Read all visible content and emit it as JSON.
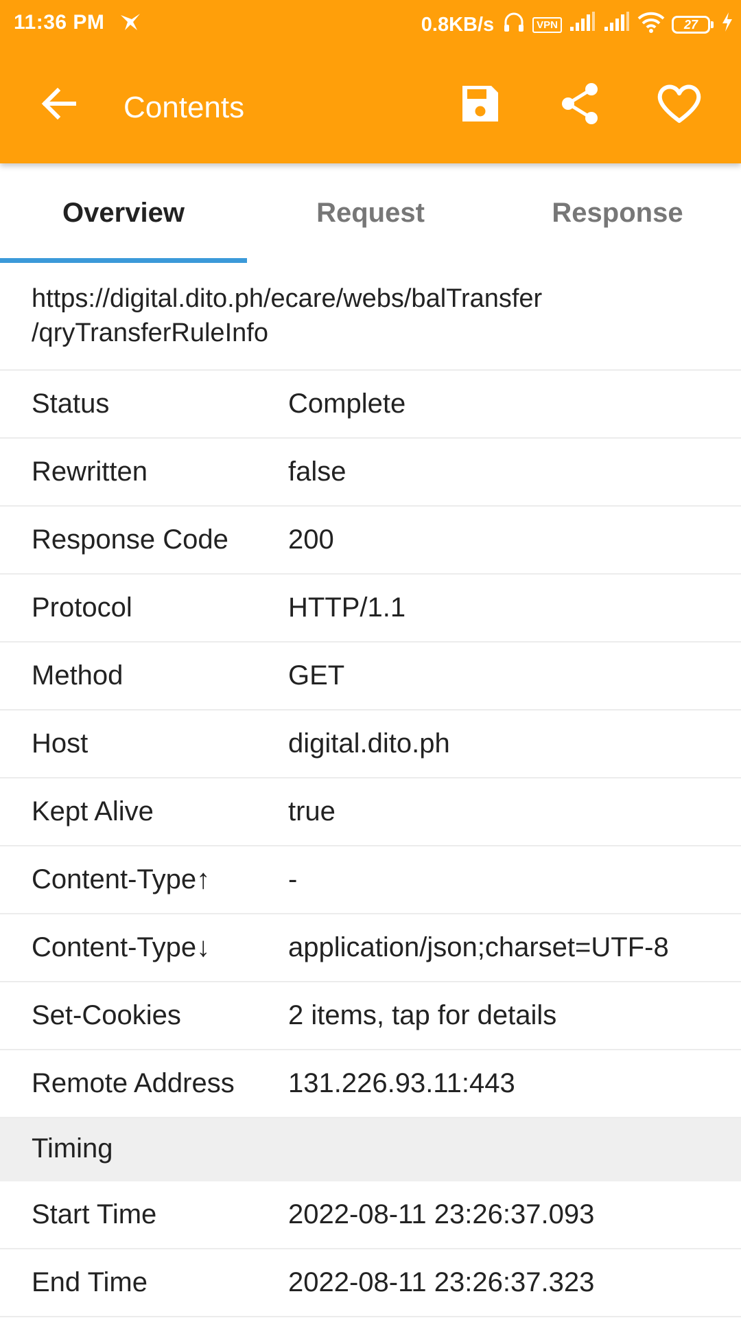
{
  "status_bar": {
    "time": "11:36 PM",
    "net_speed": "0.8KB/s",
    "vpn": "VPN",
    "battery": "27"
  },
  "toolbar": {
    "title": "Contents",
    "icons": [
      "back-arrow-icon",
      "save-icon",
      "share-icon",
      "heart-icon"
    ]
  },
  "tabs": [
    {
      "label": "Overview",
      "active": true
    },
    {
      "label": "Request",
      "active": false
    },
    {
      "label": "Response",
      "active": false
    }
  ],
  "url": {
    "line1": "https://digital.dito.ph/ecare/webs/balTransfer",
    "line2": "/qryTransferRuleInfo"
  },
  "overview": [
    {
      "key": "Status",
      "value": "Complete"
    },
    {
      "key": "Rewritten",
      "value": "false"
    },
    {
      "key": "Response Code",
      "value": "200"
    },
    {
      "key": "Protocol",
      "value": "HTTP/1.1"
    },
    {
      "key": "Method",
      "value": "GET"
    },
    {
      "key": "Host",
      "value": "digital.dito.ph"
    },
    {
      "key": "Kept Alive",
      "value": "true"
    },
    {
      "key": "Content-Type↑",
      "value": "-"
    },
    {
      "key": "Content-Type↓",
      "value": "application/json;charset=UTF-8"
    },
    {
      "key": "Set-Cookies",
      "value": "2 items, tap for details"
    },
    {
      "key": "Remote Address",
      "value": "131.226.93.11:443"
    }
  ],
  "timing": {
    "header": "Timing",
    "rows": [
      {
        "key": "Start Time",
        "value": "2022-08-11 23:26:37.093"
      },
      {
        "key": "End Time",
        "value": "2022-08-11 23:26:37.323"
      }
    ]
  },
  "colors": {
    "app_bar": "#FF9F0A",
    "tab_indicator": "#3b9ad9",
    "section_bg": "#efefef"
  }
}
